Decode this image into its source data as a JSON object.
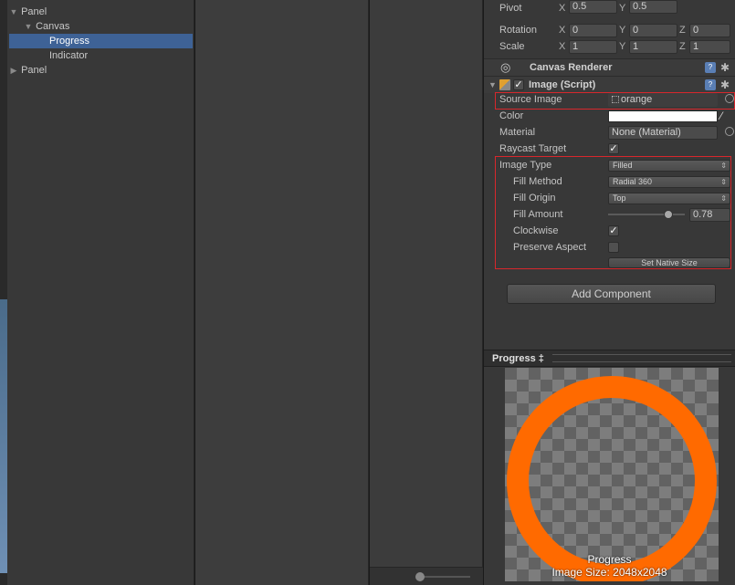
{
  "hierarchy": {
    "items": [
      {
        "label": "Panel",
        "arrow": "▼"
      },
      {
        "label": "Canvas",
        "arrow": "▼"
      },
      {
        "label": "Progress",
        "arrow": ""
      },
      {
        "label": "Indicator",
        "arrow": ""
      },
      {
        "label": "Panel",
        "arrow": "▶"
      }
    ],
    "selected": "Progress"
  },
  "inspector": {
    "pivot": {
      "label": "Pivot",
      "x_axis": "X",
      "x": "0.5",
      "y_axis": "Y",
      "y": "0.5"
    },
    "rotation": {
      "label": "Rotation",
      "x_axis": "X",
      "x": "0",
      "y_axis": "Y",
      "y": "0",
      "z_axis": "Z",
      "z": "0"
    },
    "scale": {
      "label": "Scale",
      "x_axis": "X",
      "x": "1",
      "y_axis": "Y",
      "y": "1",
      "z_axis": "Z",
      "z": "1"
    },
    "canvas_renderer": {
      "title": "Canvas Renderer"
    },
    "image_script": {
      "title": "Image (Script)",
      "source_image": {
        "label": "Source Image",
        "value": "orange"
      },
      "color": {
        "label": "Color",
        "value": "#ffffff"
      },
      "material": {
        "label": "Material",
        "value": "None (Material)"
      },
      "raycast_target": {
        "label": "Raycast Target",
        "checked": true
      },
      "image_type": {
        "label": "Image Type",
        "value": "Filled"
      },
      "fill_method": {
        "label": "Fill Method",
        "value": "Radial 360"
      },
      "fill_origin": {
        "label": "Fill Origin",
        "value": "Top"
      },
      "fill_amount": {
        "label": "Fill Amount",
        "value": "0.78",
        "slider_fraction": 0.78
      },
      "clockwise": {
        "label": "Clockwise",
        "checked": true
      },
      "preserve_aspect": {
        "label": "Preserve Aspect",
        "checked": false
      },
      "set_native_size": "Set Native Size"
    },
    "add_component": "Add Component"
  },
  "preview": {
    "title": "Progress",
    "title_arrow": "‡",
    "caption_name": "Progress",
    "caption_size": "Image Size: 2048x2048",
    "ring_color": "#ff6a00"
  },
  "colors": {
    "highlight": "#d8272c",
    "selection": "#3e6296"
  }
}
